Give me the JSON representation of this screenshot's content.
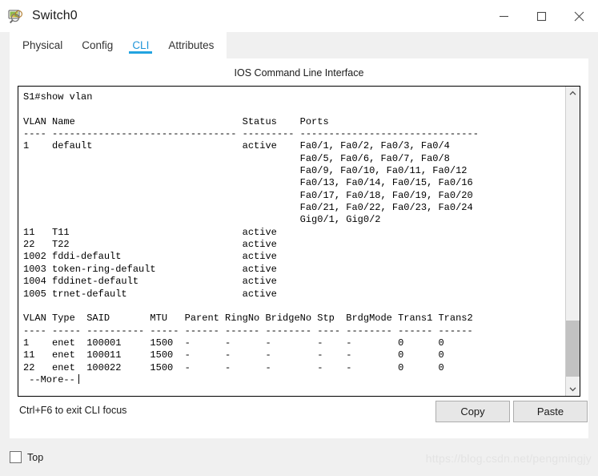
{
  "window": {
    "title": "Switch0",
    "icon": "switch-device-icon",
    "controls": [
      {
        "name": "minimize",
        "glyph": "minimize-icon"
      },
      {
        "name": "maximize",
        "glyph": "maximize-icon"
      },
      {
        "name": "close",
        "glyph": "close-icon"
      }
    ]
  },
  "tabs": [
    {
      "label": "Physical",
      "active": false
    },
    {
      "label": "Config",
      "active": false
    },
    {
      "label": "CLI",
      "active": true
    },
    {
      "label": "Attributes",
      "active": false
    }
  ],
  "panel": {
    "title": "IOS Command Line Interface"
  },
  "terminal": {
    "text": "S1#show vlan\n\nVLAN Name                             Status    Ports\n---- -------------------------------- --------- -------------------------------\n1    default                          active    Fa0/1, Fa0/2, Fa0/3, Fa0/4\n                                                Fa0/5, Fa0/6, Fa0/7, Fa0/8\n                                                Fa0/9, Fa0/10, Fa0/11, Fa0/12\n                                                Fa0/13, Fa0/14, Fa0/15, Fa0/16\n                                                Fa0/17, Fa0/18, Fa0/19, Fa0/20\n                                                Fa0/21, Fa0/22, Fa0/23, Fa0/24\n                                                Gig0/1, Gig0/2\n11   T11                              active\n22   T22                              active\n1002 fddi-default                     active\n1003 token-ring-default               active\n1004 fddinet-default                  active\n1005 trnet-default                    active\n\nVLAN Type  SAID       MTU   Parent RingNo BridgeNo Stp  BrdgMode Trans1 Trans2\n---- ----- ---------- ----- ------ ------ -------- ---- -------- ------ ------\n1    enet  100001     1500  -      -      -        -    -        0      0\n11   enet  100011     1500  -      -      -        -    -        0      0\n22   enet  100022     1500  -      -      -        -    -        0      0\n --More--",
    "prompt": "S1#",
    "command": "show vlan",
    "more_marker": "--More--",
    "vlan_table": {
      "headers": [
        "VLAN",
        "Name",
        "Status",
        "Ports"
      ],
      "rows": [
        {
          "vlan": "1",
          "name": "default",
          "status": "active",
          "ports": [
            "Fa0/1, Fa0/2, Fa0/3, Fa0/4",
            "Fa0/5, Fa0/6, Fa0/7, Fa0/8",
            "Fa0/9, Fa0/10, Fa0/11, Fa0/12",
            "Fa0/13, Fa0/14, Fa0/15, Fa0/16",
            "Fa0/17, Fa0/18, Fa0/19, Fa0/20",
            "Fa0/21, Fa0/22, Fa0/23, Fa0/24",
            "Gig0/1, Gig0/2"
          ]
        },
        {
          "vlan": "11",
          "name": "T11",
          "status": "active",
          "ports": []
        },
        {
          "vlan": "22",
          "name": "T22",
          "status": "active",
          "ports": []
        },
        {
          "vlan": "1002",
          "name": "fddi-default",
          "status": "active",
          "ports": []
        },
        {
          "vlan": "1003",
          "name": "token-ring-default",
          "status": "active",
          "ports": []
        },
        {
          "vlan": "1004",
          "name": "fddinet-default",
          "status": "active",
          "ports": []
        },
        {
          "vlan": "1005",
          "name": "trnet-default",
          "status": "active",
          "ports": []
        }
      ]
    },
    "detail_table": {
      "headers": [
        "VLAN",
        "Type",
        "SAID",
        "MTU",
        "Parent",
        "RingNo",
        "BridgeNo",
        "Stp",
        "BrdgMode",
        "Trans1",
        "Trans2"
      ],
      "rows": [
        [
          "1",
          "enet",
          "100001",
          "1500",
          "-",
          "-",
          "-",
          "-",
          "-",
          "0",
          "0"
        ],
        [
          "11",
          "enet",
          "100011",
          "1500",
          "-",
          "-",
          "-",
          "-",
          "-",
          "0",
          "0"
        ],
        [
          "22",
          "enet",
          "100022",
          "1500",
          "-",
          "-",
          "-",
          "-",
          "-",
          "0",
          "0"
        ]
      ]
    }
  },
  "scrollbar": {
    "up_glyph": "chevron-up-icon",
    "down_glyph": "chevron-down-icon",
    "thumb_top_pct": 78,
    "thumb_height_pct": 20
  },
  "controls": {
    "hint": "Ctrl+F6 to exit CLI focus",
    "copy_label": "Copy",
    "paste_label": "Paste"
  },
  "footer": {
    "top_label": "Top",
    "top_checked": false,
    "watermark": "https://blog.csdn.net/pengmingjy"
  },
  "colors": {
    "accent": "#22a3e0",
    "window_bg": "#f0f0f0",
    "panel_bg": "#ffffff",
    "terminal_text": "#000000",
    "button_face": "#e7e7e7",
    "scroll_thumb": "#c2c2c2",
    "watermark": "#e3e3e3"
  }
}
